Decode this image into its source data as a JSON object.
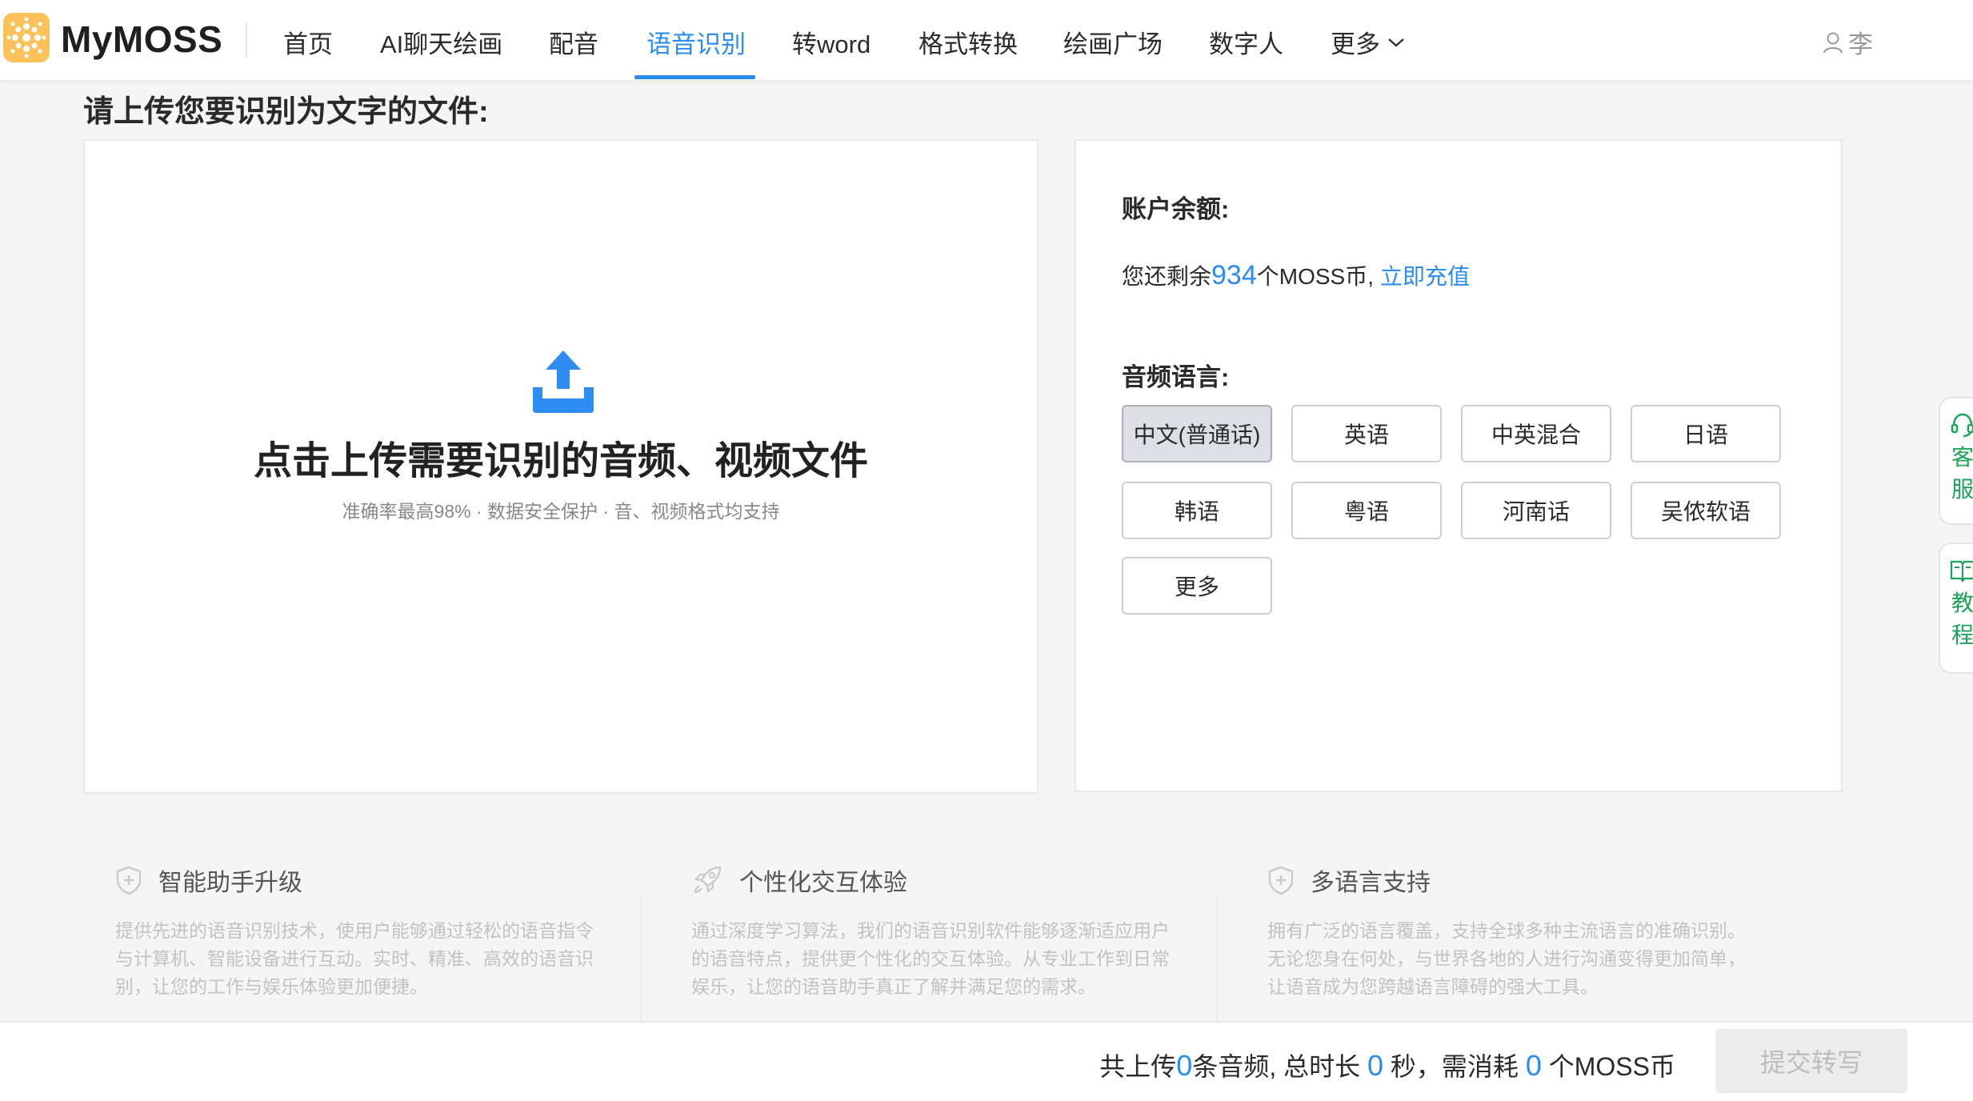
{
  "app": {
    "name": "MyMOSS"
  },
  "nav": {
    "items": [
      {
        "label": "首页"
      },
      {
        "label": "AI聊天绘画"
      },
      {
        "label": "配音"
      },
      {
        "label": "语音识别"
      },
      {
        "label": "转word"
      },
      {
        "label": "格式转换"
      },
      {
        "label": "绘画广场"
      },
      {
        "label": "数字人"
      },
      {
        "label": "更多"
      }
    ],
    "active": "语音识别",
    "user": "李"
  },
  "main": {
    "title": "请上传您要识别为文字的文件:",
    "upload": {
      "title": "点击上传需要识别的音频、视频文件",
      "subtitle": "准确率最高98% · 数据安全保护 · 音、视频格式均支持"
    }
  },
  "account": {
    "label": "账户余额:",
    "prefix": "您还剩余",
    "balance": "934",
    "unit": "个MOSS币,",
    "recharge": "立即充值"
  },
  "language": {
    "label": "音频语言:",
    "options": [
      "中文(普通话)",
      "英语",
      "中英混合",
      "日语",
      "韩语",
      "粤语",
      "河南话",
      "吴侬软语",
      "更多"
    ],
    "selected": "中文(普通话)"
  },
  "side": {
    "service": "客服",
    "tutorial": "教程"
  },
  "features": [
    {
      "title": "智能助手升级",
      "icon": "shield-icon",
      "desc": "提供先进的语音识别技术，使用户能够通过轻松的语音指令与计算机、智能设备进行互动。实时、精准、高效的语音识别，让您的工作与娱乐体验更加便捷。"
    },
    {
      "title": "个性化交互体验",
      "icon": "rocket-icon",
      "desc": "通过深度学习算法，我们的语音识别软件能够逐渐适应用户的语音特点，提供更个性化的交互体验。从专业工作到日常娱乐，让您的语音助手真正了解并满足您的需求。"
    },
    {
      "title": "多语言支持",
      "icon": "shield-icon",
      "desc": "拥有广泛的语言覆盖，支持全球多种主流语言的准确识别。无论您身在何处，与世界各地的人进行沟通变得更加简单，让语音成为您跨越语言障碍的强大工具。"
    }
  ],
  "footer": {
    "p1": "共上传",
    "count": "0",
    "p2": "条音频,  总时长",
    "duration": "0",
    "p3": "秒，需消耗",
    "cost": "0",
    "p4": "个MOSS币",
    "submit": "提交转写"
  },
  "colors": {
    "accent": "#2b8cf0",
    "side": "#1ea35a",
    "logo": "#f7b733"
  }
}
